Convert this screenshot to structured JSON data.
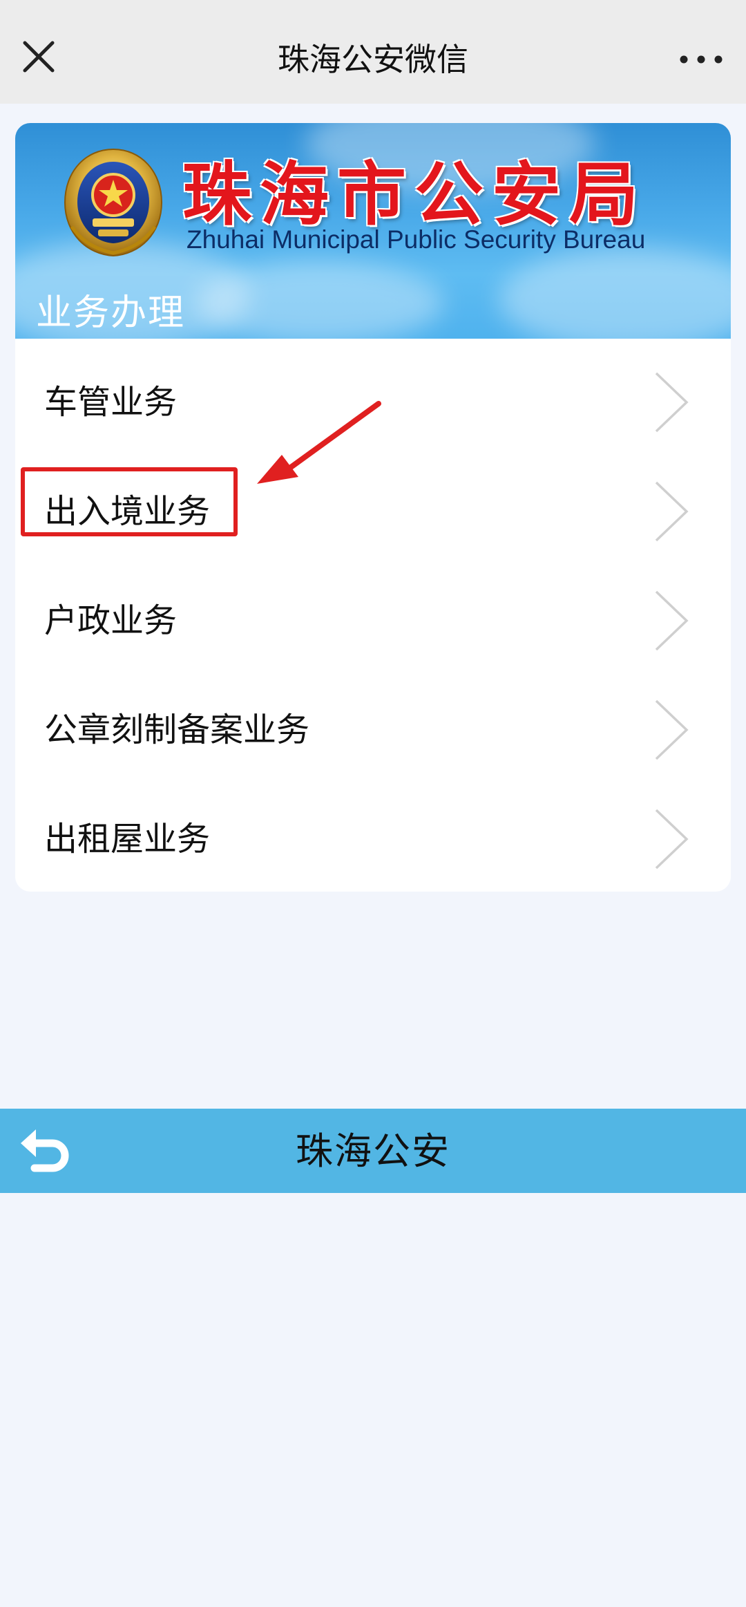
{
  "topbar": {
    "title": "珠海公安微信",
    "close_icon": "close-icon",
    "more_icon": "more-icon"
  },
  "banner": {
    "emblem": "police-emblem-icon",
    "bureau_name_cn": "珠海市公安局",
    "bureau_name_en": "Zhuhai Municipal Public Security Bureau",
    "section_title": "业务办理"
  },
  "menu": {
    "items": [
      {
        "label": "车管业务"
      },
      {
        "label": "出入境业务"
      },
      {
        "label": "户政业务"
      },
      {
        "label": "公章刻制备案业务"
      },
      {
        "label": "出租屋业务"
      }
    ],
    "highlighted_index": 1,
    "chevron_icon": "chevron-right-icon"
  },
  "colors": {
    "topbar_bg": "#ececec",
    "page_bg": "#f2f5fc",
    "banner_blue": "#48a8e8",
    "bureau_red": "#e3161c",
    "highlight_red": "#e02020",
    "bottombar_bg": "#52b6e4"
  },
  "bottombar": {
    "title": "珠海公安",
    "back_icon": "back-arrow-icon"
  }
}
